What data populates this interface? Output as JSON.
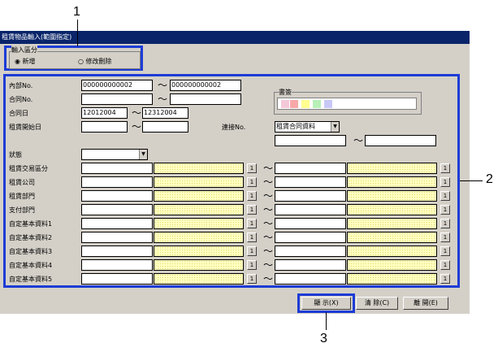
{
  "window": {
    "title": "租賃物品輸入(範圍指定)"
  },
  "input_group": {
    "label": "輸入區分",
    "options": [
      "新增",
      "修改刪除"
    ],
    "selected": "新增"
  },
  "fields": {
    "internal_no": {
      "label": "內部No.",
      "from": "000000000002",
      "to": "000000000002"
    },
    "contract_no": {
      "label": "合同No.",
      "from": "",
      "to": ""
    },
    "contract_date": {
      "label": "合同日",
      "from": "12012004",
      "to": "12312004"
    },
    "lease_start_date": {
      "label": "租賃開始日",
      "from": "",
      "to": ""
    },
    "status": {
      "label": "狀態",
      "value": ""
    },
    "link_no": {
      "label": "連接No.",
      "value": "租賃合同資料",
      "from": "",
      "to": ""
    }
  },
  "document": {
    "label": "書簽"
  },
  "tilde": "～",
  "range_rows": [
    {
      "label": "租賃交易區分",
      "btn": "1"
    },
    {
      "label": "租賃公司",
      "btn": "1"
    },
    {
      "label": "租賃部門",
      "btn": "1"
    },
    {
      "label": "支付部門",
      "btn": "1"
    },
    {
      "label": "自定基本資料1",
      "btn": "1"
    },
    {
      "label": "自定基本資料2",
      "btn": "1"
    },
    {
      "label": "自定基本資料3",
      "btn": "1"
    },
    {
      "label": "自定基本資料4",
      "btn": "1"
    },
    {
      "label": "自定基本資料5",
      "btn": "1"
    }
  ],
  "buttons": {
    "display": "顯 示(X)",
    "clear": "清 除(C)",
    "close": "離 開(E)"
  },
  "callouts": {
    "c1": "1",
    "c2": "2",
    "c3": "3"
  },
  "colors": {
    "title_bar": "#0a246a",
    "callout_box": "#1d3cd6",
    "window_bg": "#d4d0c8",
    "highlight_field": "#ffffc0"
  }
}
